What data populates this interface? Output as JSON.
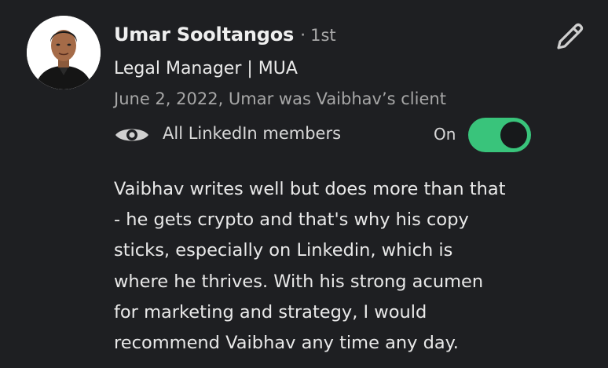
{
  "recommendation": {
    "name": "Umar Sooltangos",
    "separator": "·",
    "connection_degree": "1st",
    "headline": "Legal Manager | MUA",
    "relationship": "June 2, 2022, Umar was Vaibhav’s client",
    "visibility": {
      "icon": "eye-icon",
      "label": "All LinkedIn members",
      "toggle_state": "On",
      "toggle_on": true
    },
    "edit_icon": "pencil-icon",
    "text_lines": [
      "Vaibhav writes well but does more than that",
      "- he gets crypto and that's why his copy",
      "sticks, especially on Linkedin, which is",
      "where he thrives. With his strong acumen",
      "for marketing and strategy, I would",
      "recommend Vaibhav any time any day."
    ]
  },
  "colors": {
    "background": "#1e1f22",
    "toggle_on": "#39c47b",
    "primary_text": "#e9e9e9",
    "secondary_text": "#a7a7a7"
  }
}
